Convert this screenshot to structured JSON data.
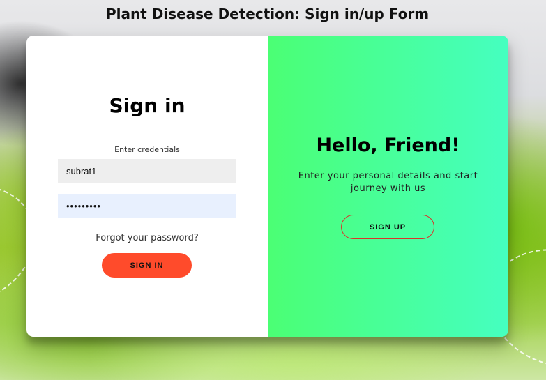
{
  "page": {
    "title": "Plant Disease Detection: Sign in/up Form"
  },
  "signin": {
    "heading": "Sign in",
    "credentials_label": "Enter credentials",
    "username_value": "subrat1",
    "password_value": "•••••••••",
    "forgot_link": "Forgot your password?",
    "button_label": "SIGN IN"
  },
  "overlay": {
    "heading": "Hello, Friend!",
    "text": "Enter your personal details and start journey with us",
    "button_label": "SIGN UP"
  },
  "colors": {
    "signin_button": "#ff4b2b",
    "overlay_gradient_start": "#4bff74",
    "overlay_gradient_end": "#45ffc0",
    "username_field_bg": "#eeeeee",
    "password_field_bg": "#e8f0fe"
  }
}
